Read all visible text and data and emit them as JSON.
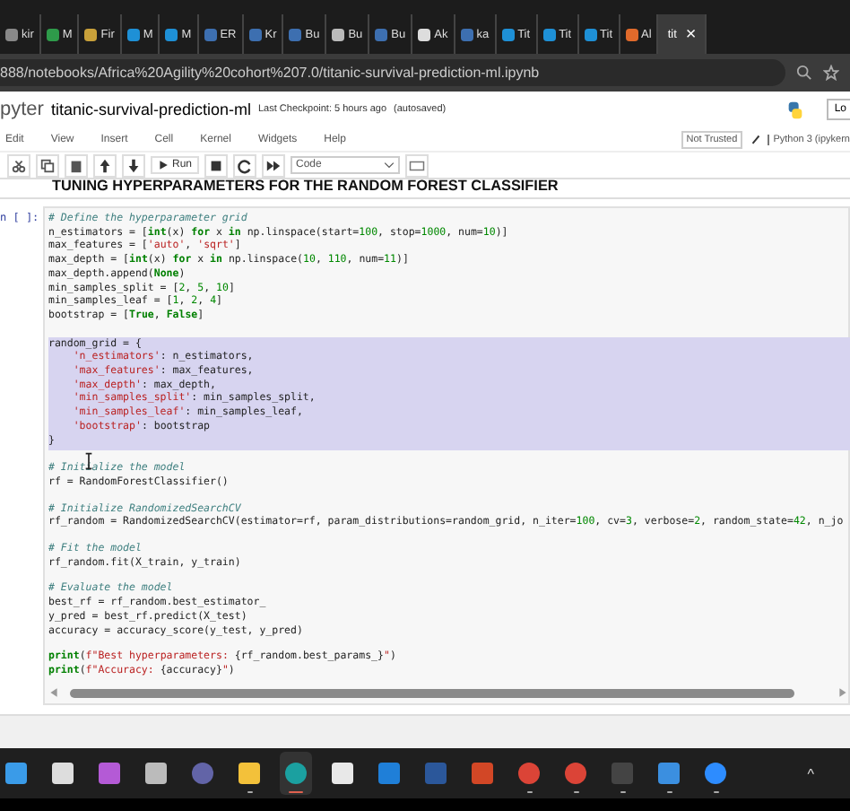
{
  "browser": {
    "tabs": [
      {
        "kind": "page",
        "label": "kir",
        "selected": false
      },
      {
        "kind": "green",
        "label": "M",
        "selected": false
      },
      {
        "kind": "bars",
        "label": "Fir",
        "selected": false
      },
      {
        "kind": "k",
        "label": "M",
        "selected": false
      },
      {
        "kind": "k",
        "label": "M",
        "selected": false
      },
      {
        "kind": "search",
        "label": "ER",
        "selected": false
      },
      {
        "kind": "search",
        "label": "Kr",
        "selected": false
      },
      {
        "kind": "search",
        "label": "Bu",
        "selected": false
      },
      {
        "kind": "dots",
        "label": "Bu",
        "selected": false
      },
      {
        "kind": "search",
        "label": "Bu",
        "selected": false
      },
      {
        "kind": "github",
        "label": "Ak",
        "selected": false
      },
      {
        "kind": "search",
        "label": "ka",
        "selected": false
      },
      {
        "kind": "k",
        "label": "Tit",
        "selected": false
      },
      {
        "kind": "k",
        "label": "Tit",
        "selected": false
      },
      {
        "kind": "k",
        "label": "Tit",
        "selected": false
      },
      {
        "kind": "ring",
        "label": "Al",
        "selected": false
      },
      {
        "kind": "plain",
        "label": "tit",
        "selected": true,
        "close": "×"
      }
    ],
    "url": "888/notebooks/Africa%20Agility%20cohort%207.0/titanic-survival-prediction-ml.ipynb"
  },
  "notebook": {
    "logo": "pyter",
    "title": "titanic-survival-prediction-ml",
    "checkpoint": "Last Checkpoint: 5 hours ago",
    "autosave": "(autosaved)",
    "logout": "Lo",
    "menu": [
      "Edit",
      "View",
      "Insert",
      "Cell",
      "Kernel",
      "Widgets",
      "Help"
    ],
    "trust": "Not Trusted",
    "kernel": "Python 3 (ipykern",
    "run": "Run",
    "cell_type": "Code",
    "heading": "TUNING HYPERPARAMETERS FOR THE RANDOM FOREST CLASSIFIER",
    "cell": {
      "prompt": "n [ ]:",
      "blocks": [
        {
          "highlighted": false,
          "lines": [
            [
              {
                "kind": "comment",
                "text": "# Define the hyperparameter grid"
              }
            ],
            [
              {
                "kind": "plain",
                "text": "n_estimators = ["
              },
              {
                "kind": "builtin",
                "text": "int"
              },
              {
                "kind": "plain",
                "text": "(x) "
              },
              {
                "kind": "keyword",
                "text": "for"
              },
              {
                "kind": "plain",
                "text": " x "
              },
              {
                "kind": "keyword",
                "text": "in"
              },
              {
                "kind": "plain",
                "text": " np.linspace(start="
              },
              {
                "kind": "number",
                "text": "100"
              },
              {
                "kind": "plain",
                "text": ", stop="
              },
              {
                "kind": "number",
                "text": "1000"
              },
              {
                "kind": "plain",
                "text": ", num="
              },
              {
                "kind": "number",
                "text": "10"
              },
              {
                "kind": "plain",
                "text": ")]"
              }
            ],
            [
              {
                "kind": "plain",
                "text": "max_features = ["
              },
              {
                "kind": "string",
                "text": "'auto'"
              },
              {
                "kind": "plain",
                "text": ", "
              },
              {
                "kind": "string",
                "text": "'sqrt'"
              },
              {
                "kind": "plain",
                "text": "]"
              }
            ],
            [
              {
                "kind": "plain",
                "text": "max_depth = ["
              },
              {
                "kind": "builtin",
                "text": "int"
              },
              {
                "kind": "plain",
                "text": "(x) "
              },
              {
                "kind": "keyword",
                "text": "for"
              },
              {
                "kind": "plain",
                "text": " x "
              },
              {
                "kind": "keyword",
                "text": "in"
              },
              {
                "kind": "plain",
                "text": " np.linspace("
              },
              {
                "kind": "number",
                "text": "10"
              },
              {
                "kind": "plain",
                "text": ", "
              },
              {
                "kind": "number",
                "text": "110"
              },
              {
                "kind": "plain",
                "text": ", num="
              },
              {
                "kind": "number",
                "text": "11"
              },
              {
                "kind": "plain",
                "text": ")]"
              }
            ],
            [
              {
                "kind": "plain",
                "text": "max_depth.append("
              },
              {
                "kind": "keyword",
                "text": "None"
              },
              {
                "kind": "plain",
                "text": ")"
              }
            ],
            [
              {
                "kind": "plain",
                "text": "min_samples_split = ["
              },
              {
                "kind": "number",
                "text": "2"
              },
              {
                "kind": "plain",
                "text": ", "
              },
              {
                "kind": "number",
                "text": "5"
              },
              {
                "kind": "plain",
                "text": ", "
              },
              {
                "kind": "number",
                "text": "10"
              },
              {
                "kind": "plain",
                "text": "]"
              }
            ],
            [
              {
                "kind": "plain",
                "text": "min_samples_leaf = ["
              },
              {
                "kind": "number",
                "text": "1"
              },
              {
                "kind": "plain",
                "text": ", "
              },
              {
                "kind": "number",
                "text": "2"
              },
              {
                "kind": "plain",
                "text": ", "
              },
              {
                "kind": "number",
                "text": "4"
              },
              {
                "kind": "plain",
                "text": "]"
              }
            ],
            [
              {
                "kind": "plain",
                "text": "bootstrap = ["
              },
              {
                "kind": "keyword",
                "text": "True"
              },
              {
                "kind": "plain",
                "text": ", "
              },
              {
                "kind": "keyword",
                "text": "False"
              },
              {
                "kind": "plain",
                "text": "]"
              }
            ]
          ]
        },
        {
          "highlighted": true,
          "lines": [
            [
              {
                "kind": "plain",
                "text": "random_grid = {"
              }
            ],
            [
              {
                "kind": "string",
                "text": "    'n_estimators'"
              },
              {
                "kind": "plain",
                "text": ": n_estimators,"
              }
            ],
            [
              {
                "kind": "string",
                "text": "    'max_features'"
              },
              {
                "kind": "plain",
                "text": ": max_features,"
              }
            ],
            [
              {
                "kind": "string",
                "text": "    'max_depth'"
              },
              {
                "kind": "plain",
                "text": ": max_depth,"
              }
            ],
            [
              {
                "kind": "string",
                "text": "    'min_samples_split'"
              },
              {
                "kind": "plain",
                "text": ": min_samples_split,"
              }
            ],
            [
              {
                "kind": "string",
                "text": "    'min_samples_leaf'"
              },
              {
                "kind": "plain",
                "text": ": min_samples_leaf,"
              }
            ],
            [
              {
                "kind": "string",
                "text": "    'bootstrap'"
              },
              {
                "kind": "plain",
                "text": ": bootstrap"
              }
            ],
            [
              {
                "kind": "plain",
                "text": "}"
              }
            ]
          ]
        },
        {
          "highlighted": false,
          "lines": [
            [
              {
                "kind": "comment",
                "text": "# Initialize the model"
              }
            ],
            [
              {
                "kind": "plain",
                "text": "rf = RandomForestClassifier()"
              }
            ]
          ]
        },
        {
          "highlighted": false,
          "lines": [
            [
              {
                "kind": "comment",
                "text": "# Initialize RandomizedSearchCV"
              }
            ],
            [
              {
                "kind": "plain",
                "text": "rf_random = RandomizedSearchCV(estimator=rf, param_distributions=random_grid, n_iter="
              },
              {
                "kind": "number",
                "text": "100"
              },
              {
                "kind": "plain",
                "text": ", cv="
              },
              {
                "kind": "number",
                "text": "3"
              },
              {
                "kind": "plain",
                "text": ", verbose="
              },
              {
                "kind": "number",
                "text": "2"
              },
              {
                "kind": "plain",
                "text": ", random_state="
              },
              {
                "kind": "number",
                "text": "42"
              },
              {
                "kind": "plain",
                "text": ", n_jo"
              }
            ]
          ]
        },
        {
          "highlighted": false,
          "lines": [
            [
              {
                "kind": "comment",
                "text": "# Fit the model"
              }
            ],
            [
              {
                "kind": "plain",
                "text": "rf_random.fit(X_train, y_train)"
              }
            ]
          ]
        },
        {
          "highlighted": false,
          "lines": [
            [
              {
                "kind": "comment",
                "text": "# Evaluate the model"
              }
            ],
            [
              {
                "kind": "plain",
                "text": "best_rf = rf_random.best_estimator_"
              }
            ],
            [
              {
                "kind": "plain",
                "text": "y_pred = best_rf.predict(X_test)"
              }
            ],
            [
              {
                "kind": "plain",
                "text": "accuracy = accuracy_score(y_test, y_pred)"
              }
            ]
          ]
        },
        {
          "highlighted": false,
          "lines": [
            [
              {
                "kind": "builtin",
                "text": "print"
              },
              {
                "kind": "plain",
                "text": "("
              },
              {
                "kind": "string",
                "text": "f\"Best hyperparameters: "
              },
              {
                "kind": "plain",
                "text": "{rf_random.best_params_}"
              },
              {
                "kind": "string",
                "text": "\""
              },
              {
                "kind": "plain",
                "text": ")"
              }
            ],
            [
              {
                "kind": "builtin",
                "text": "print"
              },
              {
                "kind": "plain",
                "text": "("
              },
              {
                "kind": "string",
                "text": "f\"Accuracy: "
              },
              {
                "kind": "plain",
                "text": "{accuracy}"
              },
              {
                "kind": "string",
                "text": "\""
              },
              {
                "kind": "plain",
                "text": ")"
              }
            ]
          ]
        }
      ]
    }
  },
  "taskbar": [
    {
      "kind": "start",
      "running": false,
      "selected": false
    },
    {
      "kind": "search",
      "running": false,
      "selected": false
    },
    {
      "kind": "copilot",
      "running": false,
      "selected": false
    },
    {
      "kind": "taskview",
      "running": false,
      "selected": false
    },
    {
      "kind": "teams",
      "running": false,
      "selected": false
    },
    {
      "kind": "folder",
      "running": true,
      "selected": false
    },
    {
      "kind": "edge",
      "running": true,
      "selected": true
    },
    {
      "kind": "store",
      "running": false,
      "selected": false
    },
    {
      "kind": "mail",
      "running": false,
      "selected": false
    },
    {
      "kind": "word",
      "running": false,
      "selected": false
    },
    {
      "kind": "powerpoint",
      "running": false,
      "selected": false
    },
    {
      "kind": "chrome",
      "running": true,
      "selected": false
    },
    {
      "kind": "chrome",
      "running": true,
      "selected": false
    },
    {
      "kind": "terminal",
      "running": true,
      "selected": false
    },
    {
      "kind": "photos",
      "running": true,
      "selected": false
    },
    {
      "kind": "zoom",
      "running": true,
      "selected": false
    }
  ],
  "tray_caret": "^"
}
